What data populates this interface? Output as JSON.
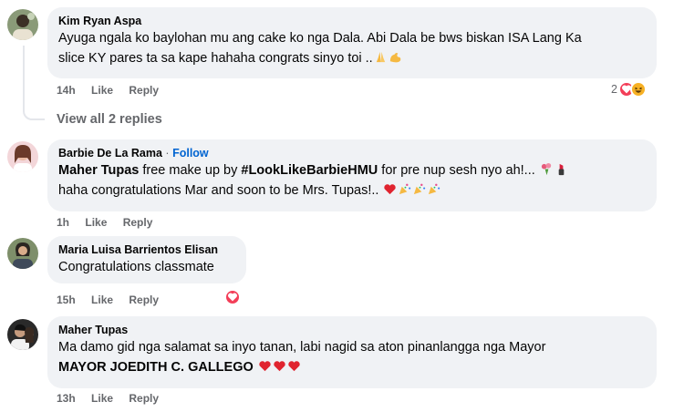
{
  "comments": [
    {
      "author": "Kim Ryan Aspa",
      "line1": "Ayuga ngala ko baylohan mu ang cake ko nga Dala. Abi Dala be bws biskan ISA Lang Ka",
      "line2": "slice KY pares ta sa kape hahaha congrats sinyo toi ..",
      "emojis_line2": [
        "folded-hands-emoji",
        "flexed-biceps-emoji"
      ],
      "time": "14h",
      "like": "Like",
      "reply": "Reply",
      "reaction_count": "2",
      "reactions": [
        "love-reaction-icon",
        "haha-reaction-icon"
      ]
    },
    {
      "view_replies": "View all 2 replies"
    },
    {
      "author": "Barbie De La Rama",
      "follow_separator": "·",
      "follow": "Follow",
      "mention": "Maher Tupas",
      "line1_mid": " free make up by ",
      "hashtag": "#LookLikeBarbieHMU",
      "line1_end": " for pre nup sesh nyo ah!... ",
      "emojis_line1": [
        "bouquet-emoji",
        "lipstick-emoji"
      ],
      "line2": "haha congratulations Mar and soon to be Mrs. Tupas!.. ",
      "emojis_line2": [
        "heart-exclamation-emoji",
        "party-popper-emoji",
        "party-popper-emoji",
        "party-popper-emoji"
      ],
      "time": "1h",
      "like": "Like",
      "reply": "Reply"
    },
    {
      "author": "Maria Luisa Barrientos Elisan",
      "line1": "Congratulations classmate",
      "time": "15h",
      "like": "Like",
      "reply": "Reply",
      "reactions": [
        "love-reaction-icon"
      ]
    },
    {
      "author": "Maher Tupas",
      "line1": "Ma damo gid nga salamat sa inyo tanan, labi nagid sa aton pinanlangga nga Mayor",
      "line2": "MAYOR JOEDITH C. GALLEGO ",
      "emojis_line2": [
        "red-heart-emoji",
        "red-heart-emoji",
        "red-heart-emoji"
      ],
      "time": "13h",
      "like": "Like",
      "reply": "Reply"
    }
  ],
  "colors": {
    "bubble": "#f0f2f5",
    "meta": "#65676b",
    "follow": "#0064d1",
    "love": "#f33e58",
    "haha": "#f7b125"
  }
}
